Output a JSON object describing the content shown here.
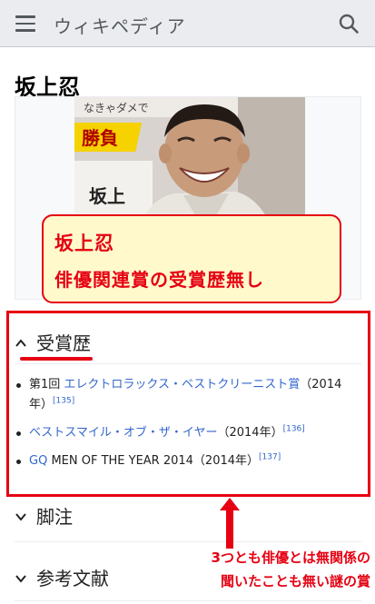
{
  "header": {
    "wordmark": "ウィキペディア"
  },
  "page": {
    "title": "坂上忍"
  },
  "infobox": {
    "photo_alt": "坂上忍の写真",
    "photo_backdrop_top": "なきゃダメで",
    "photo_backdrop_banner": "勝負",
    "photo_backdrop_name": "坂上"
  },
  "callout": {
    "line1": "坂上忍",
    "line2": "俳優関連賞の受賞歴無し"
  },
  "sections": {
    "awards": {
      "title": "受賞歴"
    },
    "notes": {
      "title": "脚注"
    },
    "references": {
      "title": "参考文献"
    }
  },
  "awards": [
    {
      "prefix": "第1回 ",
      "link": "エレクトロラックス・ベストクリーニスト賞",
      "suffix": "（2014年）",
      "ref": "[135]"
    },
    {
      "prefix": "",
      "link": "ベストスマイル・オブ・ザ・イヤー",
      "suffix": "（2014年）",
      "ref": "[136]"
    },
    {
      "prefix": "",
      "link": "GQ",
      "suffix": " MEN OF THE YEAR 2014（2014年）",
      "ref": "[137]"
    }
  ],
  "annotation": {
    "line1": "3つとも俳優とは無関係の",
    "line2": "聞いたことも無い謎の賞"
  },
  "colors": {
    "accent_red": "#e60012",
    "link_blue": "#3366cc",
    "header_gray": "#eaecf0",
    "callout_fill": "#fff9cc"
  }
}
